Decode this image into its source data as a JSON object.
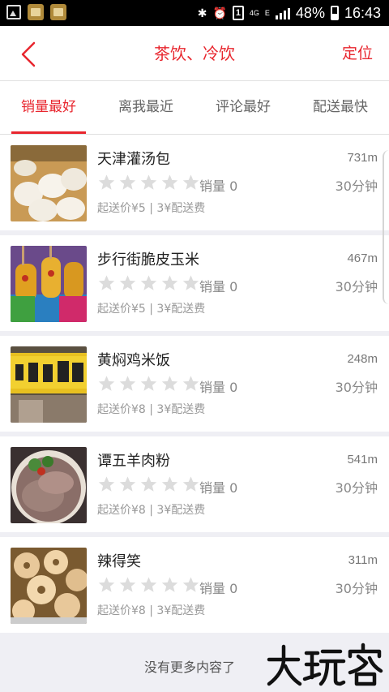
{
  "status_bar": {
    "network": "4G",
    "signal_type": "E",
    "battery": "48%",
    "time": "16:43"
  },
  "header": {
    "title": "茶饮、冷饮",
    "right_action": "定位"
  },
  "tabs": [
    {
      "label": "销量最好",
      "active": true
    },
    {
      "label": "离我最近",
      "active": false
    },
    {
      "label": "评论最好",
      "active": false
    },
    {
      "label": "配送最快",
      "active": false
    }
  ],
  "shops": [
    {
      "name": "天津灌汤包",
      "distance": "731m",
      "sales": "销量 0",
      "delivery_time": "30分钟",
      "meta": "起送价¥5 | 3¥配送费",
      "image": "soup-dumplings"
    },
    {
      "name": "步行街脆皮玉米",
      "distance": "467m",
      "sales": "销量 0",
      "delivery_time": "30分钟",
      "meta": "起送价¥5 | 3¥配送费",
      "image": "crispy-corn"
    },
    {
      "name": "黄焖鸡米饭",
      "distance": "248m",
      "sales": "销量 0",
      "delivery_time": "30分钟",
      "meta": "起送价¥8 | 3¥配送费",
      "image": "storefront-sign"
    },
    {
      "name": "谭五羊肉粉",
      "distance": "541m",
      "sales": "销量 0",
      "delivery_time": "30分钟",
      "meta": "起送价¥8 | 3¥配送费",
      "image": "mutton-noodles"
    },
    {
      "name": "辣得笑",
      "distance": "311m",
      "sales": "销量 0",
      "delivery_time": "30分钟",
      "meta": "起送价¥8 | 3¥配送费",
      "image": "lotus-root"
    }
  ],
  "footer": {
    "no_more": "没有更多内容了",
    "watermark": "大玩客"
  },
  "colors": {
    "accent": "#e8262e",
    "star": "#dcdcdc"
  }
}
